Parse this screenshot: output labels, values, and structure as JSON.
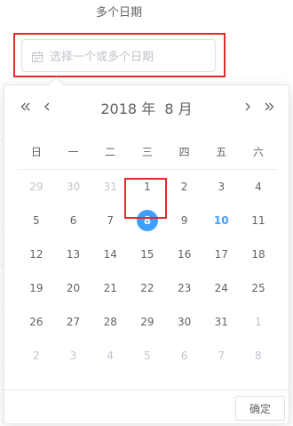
{
  "form": {
    "title": "多个日期",
    "input_placeholder": "选择一个或多个日期"
  },
  "picker": {
    "year": "2018",
    "year_unit": "年",
    "month": "8",
    "month_unit": "月",
    "weekdays": [
      "日",
      "一",
      "二",
      "三",
      "四",
      "五",
      "六"
    ],
    "weeks": [
      [
        "29",
        "30",
        "31",
        "1",
        "2",
        "3",
        "4"
      ],
      [
        "5",
        "6",
        "7",
        "8",
        "9",
        "10",
        "11"
      ],
      [
        "12",
        "13",
        "14",
        "15",
        "16",
        "17",
        "18"
      ],
      [
        "19",
        "20",
        "21",
        "22",
        "23",
        "24",
        "25"
      ],
      [
        "26",
        "27",
        "28",
        "29",
        "30",
        "31",
        "1"
      ],
      [
        "2",
        "3",
        "4",
        "5",
        "6",
        "7",
        "8"
      ]
    ],
    "muted_days": [
      [
        0,
        0
      ],
      [
        0,
        1
      ],
      [
        0,
        2
      ],
      [
        4,
        6
      ],
      [
        5,
        0
      ],
      [
        5,
        1
      ],
      [
        5,
        2
      ],
      [
        5,
        3
      ],
      [
        5,
        4
      ],
      [
        5,
        5
      ],
      [
        5,
        6
      ]
    ],
    "selected_day": [
      1,
      3
    ],
    "today_day": [
      1,
      5
    ],
    "confirm_label": "确定"
  },
  "icons": {
    "input": "calendar-icon",
    "prev_year": "double-chevron-left-icon",
    "prev_month": "chevron-left-icon",
    "next_month": "chevron-right-icon",
    "next_year": "double-chevron-right-icon"
  },
  "colors": {
    "accent": "#409eff",
    "highlight_box": "#e02b2b",
    "muted_text": "#c0c4cc",
    "text": "#606266"
  }
}
